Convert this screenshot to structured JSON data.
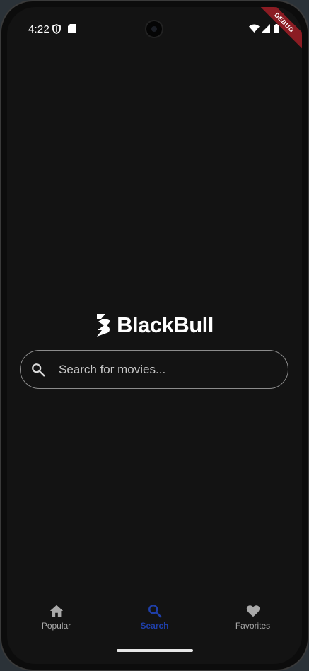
{
  "status_bar": {
    "time": "4:22",
    "icons": [
      "shield-icon",
      "sd-card-icon",
      "wifi-icon",
      "signal-icon",
      "battery-icon"
    ],
    "debug_label": "DEBUG"
  },
  "logo": {
    "name": "BlackBull"
  },
  "search": {
    "placeholder": "Search for movies...",
    "value": ""
  },
  "bottom_nav": {
    "items": [
      {
        "label": "Popular",
        "icon": "home-icon",
        "active": false
      },
      {
        "label": "Search",
        "icon": "search-icon",
        "active": true
      },
      {
        "label": "Favorites",
        "icon": "heart-icon",
        "active": false
      }
    ]
  },
  "colors": {
    "background": "#131313",
    "active_nav": "#1f3fa8",
    "inactive_nav": "#a9a9a9",
    "debug_banner": "#8b1c23"
  }
}
